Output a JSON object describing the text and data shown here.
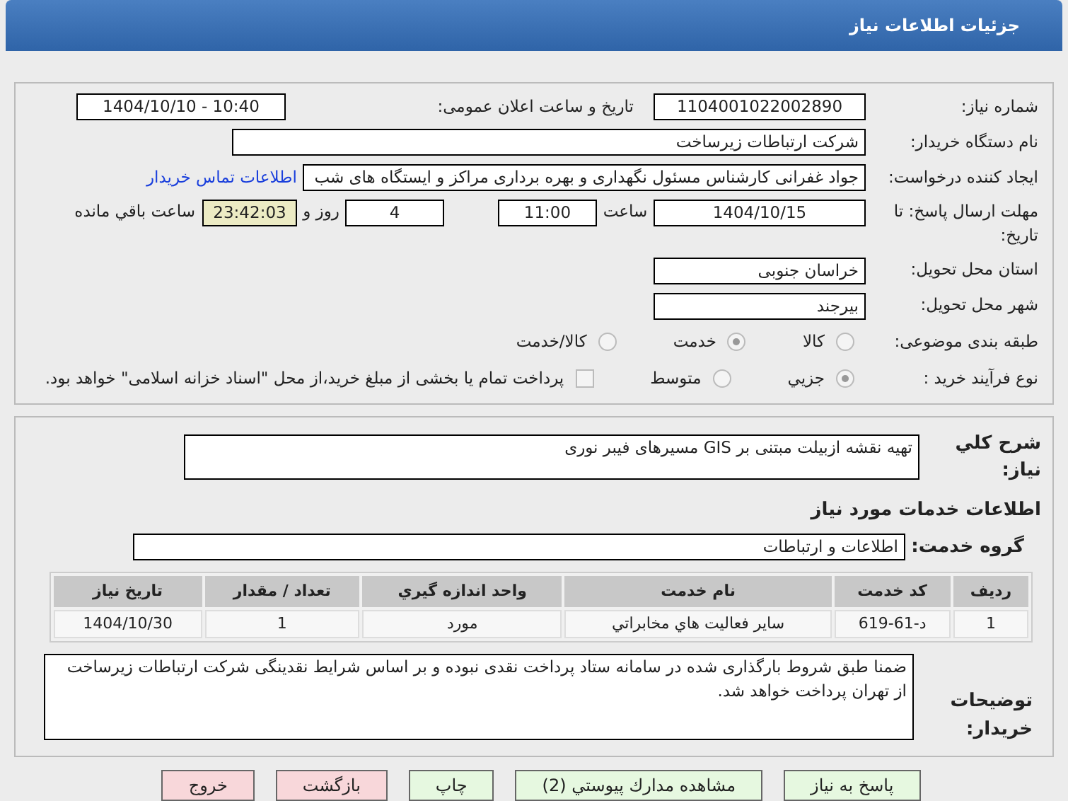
{
  "window": {
    "title": "جزئیات اطلاعات نیاز"
  },
  "need_number": {
    "label": "شماره نیاز:",
    "value": "1104001022002890"
  },
  "announce_datetime": {
    "label": "تاریخ و ساعت اعلان عمومی:",
    "value": "1404/10/10 - 10:40"
  },
  "buyer_org": {
    "label": "نام دستگاه خریدار:",
    "value": "شرکت ارتباطات زیرساخت"
  },
  "requester": {
    "label": "ایجاد کننده درخواست:",
    "value": "جواد غفرانی کارشناس مسئول نگهداری و بهره برداری مراکز و ایستگاه های شب",
    "link": "اطلاعات تماس خریدار"
  },
  "deadline": {
    "label": "مهلت ارسال پاسخ: تا تاریخ:",
    "date": "1404/10/15",
    "time_label": "ساعت",
    "time": "11:00",
    "days": "4",
    "days_label": "روز و",
    "remaining": "23:42:03",
    "remaining_label": "ساعت باقي مانده"
  },
  "province": {
    "label": "استان محل تحویل:",
    "value": "خراسان جنوبی"
  },
  "city": {
    "label": "شهر محل تحویل:",
    "value": "بیرجند"
  },
  "category": {
    "label": "طبقه بندی موضوعی:",
    "options": [
      {
        "label": "کالا",
        "selected": false
      },
      {
        "label": "خدمت",
        "selected": true
      },
      {
        "label": "کالا/خدمت",
        "selected": false
      }
    ]
  },
  "purchase_process": {
    "label": "نوع فرآیند خرید :",
    "options": [
      {
        "label": "جزيي",
        "selected": true
      },
      {
        "label": "متوسط",
        "selected": false
      }
    ],
    "treasury": {
      "checked": false,
      "text": "پرداخت تمام یا بخشی از مبلغ خرید،از محل \"اسناد خزانه اسلامی\" خواهد بود."
    }
  },
  "description": {
    "label": "شرح كلي نياز:",
    "value": "تهیه نقشه ازبیلت مبتنی بر GIS مسیرهای فیبر نوری"
  },
  "services_heading": "اطلاعات خدمات مورد نياز",
  "service_group": {
    "label": "گروه خدمت:",
    "value": "اطلاعات و ارتباطات"
  },
  "table": {
    "columns": [
      "رديف",
      "كد خدمت",
      "نام خدمت",
      "واحد اندازه گيري",
      "تعداد / مقدار",
      "تاريخ نياز"
    ],
    "rows": [
      [
        "1",
        "د-61-619",
        "ساير فعاليت هاي مخابراتي",
        "مورد",
        "1",
        "1404/10/30"
      ]
    ]
  },
  "buyer_notes": {
    "label": "توضيحات خريدار:",
    "value": "ضمنا طبق شروط بارگذاری شده در سامانه ستاد پرداخت نقدی نبوده و بر اساس شرایط نقدینگی شرکت ارتباطات زیرساخت از تهران پرداخت خواهد شد."
  },
  "buttons": [
    {
      "label": "پاسخ به نياز",
      "kind": "normal"
    },
    {
      "label": "مشاهده مدارك پيوستي (2)",
      "kind": "normal"
    },
    {
      "label": "چاپ",
      "kind": "normal"
    },
    {
      "label": "بازگشت",
      "kind": "danger"
    },
    {
      "label": "خروج",
      "kind": "danger"
    }
  ]
}
